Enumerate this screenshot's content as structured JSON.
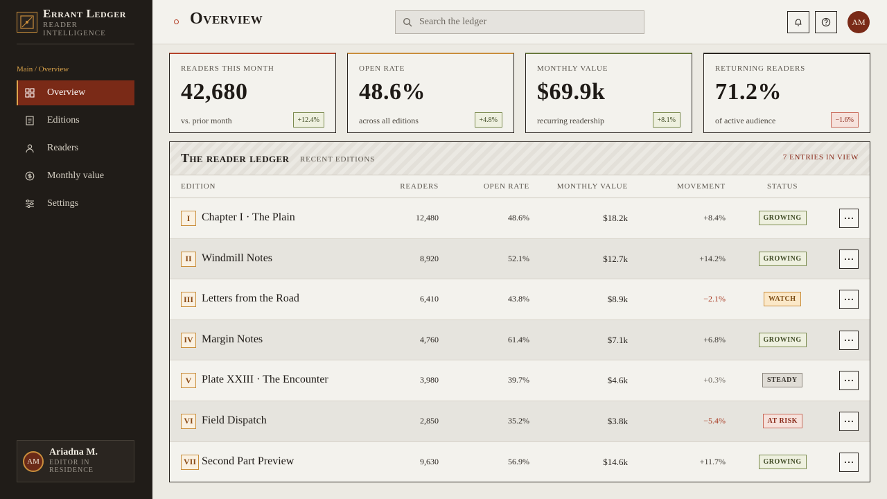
{
  "brand": {
    "title": "Errant Ledger",
    "subtitle": "Reader Intelligence"
  },
  "breadcrumb": "Main / Overview",
  "nav": [
    {
      "label": "Overview",
      "icon": "grid-icon",
      "active": true
    },
    {
      "label": "Editions",
      "icon": "document-icon",
      "active": false
    },
    {
      "label": "Readers",
      "icon": "person-icon",
      "active": false
    },
    {
      "label": "Monthly value",
      "icon": "coin-icon",
      "active": false
    },
    {
      "label": "Settings",
      "icon": "sliders-icon",
      "active": false
    }
  ],
  "user": {
    "initials": "AM",
    "name": "Ariadna M.",
    "role": "Editor in Residence"
  },
  "header": {
    "title": "Overview",
    "search_placeholder": "Search the ledger",
    "avatar_initials": "AM"
  },
  "kpis": [
    {
      "label": "Readers this month",
      "value": "42,680",
      "note": "vs. prior month",
      "badge": "+12.4%",
      "trend": "up",
      "accent": "#b5432a"
    },
    {
      "label": "Open rate",
      "value": "48.6%",
      "note": "across all editions",
      "badge": "+4.8%",
      "trend": "up",
      "accent": "#c98e3c"
    },
    {
      "label": "Monthly value",
      "value": "$69.9k",
      "note": "recurring readership",
      "badge": "+8.1%",
      "trend": "up",
      "accent": "#6a7a3e"
    },
    {
      "label": "Returning readers",
      "value": "71.2%",
      "note": "of active audience",
      "badge": "−1.6%",
      "trend": "down",
      "accent": "#2a2520"
    }
  ],
  "table": {
    "title": "The reader ledger",
    "subtitle": "Recent editions",
    "count": "7 entries in view",
    "columns": {
      "edition": "Edition",
      "readers": "Readers",
      "open_rate": "Open rate",
      "monthly_value": "Monthly value",
      "movement": "Movement",
      "status": "Status"
    },
    "rows": [
      {
        "num": "I",
        "name": "Chapter I · The Plain",
        "readers": "12,480",
        "open_rate": "48.6%",
        "value": "$18.2k",
        "movement": "+8.4%",
        "mv": "pos",
        "status": "Growing",
        "st": "growing"
      },
      {
        "num": "II",
        "name": "Windmill Notes",
        "readers": "8,920",
        "open_rate": "52.1%",
        "value": "$12.7k",
        "movement": "+14.2%",
        "mv": "pos",
        "status": "Growing",
        "st": "growing"
      },
      {
        "num": "III",
        "name": "Letters from the Road",
        "readers": "6,410",
        "open_rate": "43.8%",
        "value": "$8.9k",
        "movement": "−2.1%",
        "mv": "neg",
        "status": "Watch",
        "st": "watch"
      },
      {
        "num": "IV",
        "name": "Margin Notes",
        "readers": "4,760",
        "open_rate": "61.4%",
        "value": "$7.1k",
        "movement": "+6.8%",
        "mv": "pos",
        "status": "Growing",
        "st": "growing"
      },
      {
        "num": "V",
        "name": "Plate XXIII · The Encounter",
        "readers": "3,980",
        "open_rate": "39.7%",
        "value": "$4.6k",
        "movement": "+0.3%",
        "mv": "flat",
        "status": "Steady",
        "st": "steady"
      },
      {
        "num": "VI",
        "name": "Field Dispatch",
        "readers": "2,850",
        "open_rate": "35.2%",
        "value": "$3.8k",
        "movement": "−5.4%",
        "mv": "neg",
        "status": "At risk",
        "st": "risk"
      },
      {
        "num": "VII",
        "name": "Second Part Preview",
        "readers": "9,630",
        "open_rate": "56.9%",
        "value": "$14.6k",
        "movement": "+11.7%",
        "mv": "pos",
        "status": "Growing",
        "st": "growing"
      }
    ]
  }
}
